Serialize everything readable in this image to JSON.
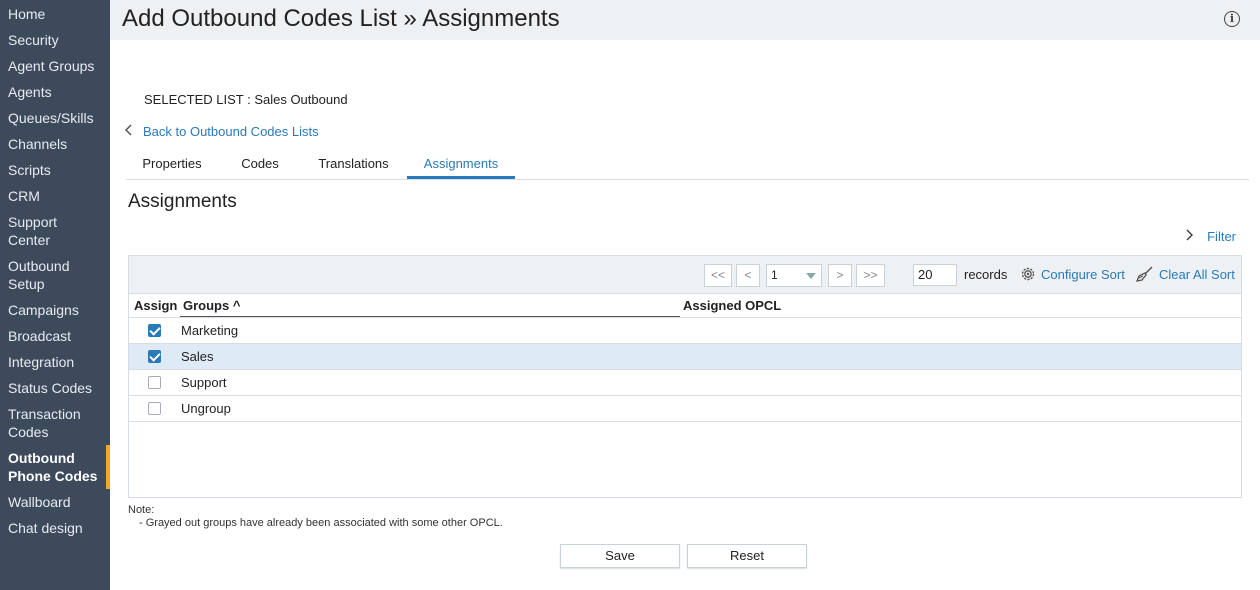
{
  "sidebar": {
    "items": [
      {
        "label": "Home"
      },
      {
        "label": "Security"
      },
      {
        "label": "Agent Groups"
      },
      {
        "label": "Agents"
      },
      {
        "label": "Queues/Skills"
      },
      {
        "label": "Channels"
      },
      {
        "label": "Scripts"
      },
      {
        "label": "CRM"
      },
      {
        "label": "Support Center"
      },
      {
        "label": "Outbound Setup"
      },
      {
        "label": "Campaigns"
      },
      {
        "label": "Broadcast"
      },
      {
        "label": "Integration"
      },
      {
        "label": "Status Codes"
      },
      {
        "label": "Transaction Codes"
      },
      {
        "label": "Outbound Phone Codes",
        "active": true
      },
      {
        "label": "Wallboard"
      },
      {
        "label": "Chat design"
      }
    ],
    "accent_color": "#f5a623"
  },
  "header": {
    "title": "Add Outbound Codes List » Assignments",
    "info_icon": "info-icon"
  },
  "selected_list": {
    "label": "SELECTED LIST",
    "value": ": Sales Outbound"
  },
  "back_link": {
    "label": "Back to Outbound Codes Lists",
    "icon": "chevron-left-icon"
  },
  "tabs": [
    {
      "label": "Properties"
    },
    {
      "label": "Codes"
    },
    {
      "label": "Translations"
    },
    {
      "label": "Assignments",
      "active": true
    }
  ],
  "section_title": "Assignments",
  "filter": {
    "label": "Filter",
    "icon": "chevron-right-icon"
  },
  "pagination": {
    "first": "<<",
    "prev": "<",
    "page": "1",
    "next": ">",
    "last": ">>",
    "records_value": "20",
    "records_label": "records"
  },
  "toolbar": {
    "configure_sort": "Configure Sort",
    "clear_sort": "Clear All Sort"
  },
  "table": {
    "headers": {
      "assign": "Assign",
      "groups": "Groups ^",
      "opcl": "Assigned OPCL"
    },
    "rows": [
      {
        "assigned": true,
        "group": "Marketing",
        "opcl": ""
      },
      {
        "assigned": true,
        "group": "Sales",
        "opcl": "",
        "selected": true
      },
      {
        "assigned": false,
        "group": "Support",
        "opcl": ""
      },
      {
        "assigned": false,
        "group": "Ungroup",
        "opcl": ""
      }
    ]
  },
  "note": {
    "title": "Note:",
    "line": "- Grayed out groups have already been associated with some other OPCL."
  },
  "buttons": {
    "save": "Save",
    "reset": "Reset"
  },
  "colors": {
    "link": "#2a7ab8",
    "sidebar_bg": "#3d4a5c",
    "selected_row": "#deeaf5"
  }
}
